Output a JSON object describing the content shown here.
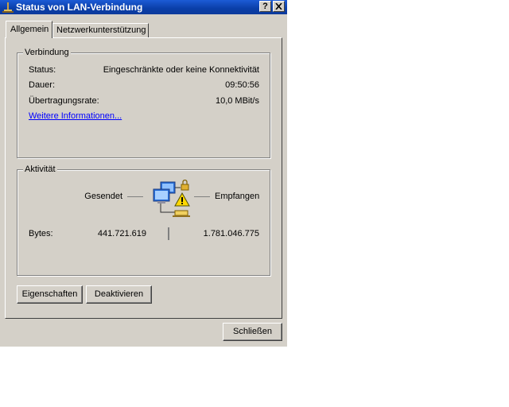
{
  "window": {
    "title": "Status von LAN-Verbindung",
    "help_label": "?",
    "close_label": "✕"
  },
  "tabs": [
    {
      "label": "Allgemein",
      "active": true
    },
    {
      "label": "Netzwerkunterstützung",
      "active": false
    }
  ],
  "connection": {
    "group_title": "Verbindung",
    "status_label": "Status:",
    "status_value": "Eingeschränkte oder keine Konnektivität",
    "duration_label": "Dauer:",
    "duration_value": "09:50:56",
    "speed_label": "Übertragungsrate:",
    "speed_value": "10,0 MBit/s",
    "more_info_link": "Weitere Informationen..."
  },
  "activity": {
    "group_title": "Aktivität",
    "sent_label": "Gesendet",
    "received_label": "Empfangen",
    "bytes_label": "Bytes:",
    "bytes_sent": "441.721.619",
    "bytes_received": "1.781.046.775",
    "icon": "network-computers-warning-icon"
  },
  "buttons": {
    "properties": "Eigenschaften",
    "disable": "Deaktivieren",
    "close": "Schließen"
  }
}
